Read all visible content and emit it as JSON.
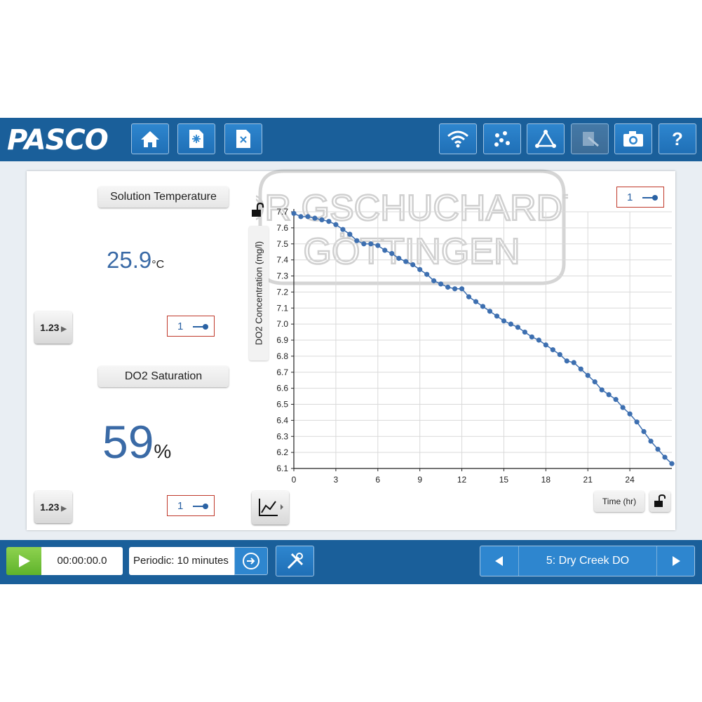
{
  "brand": {
    "logo": "PASCO"
  },
  "toolbar": {
    "left_icons": [
      "home-icon",
      "new-file-icon",
      "close-file-icon"
    ],
    "right_icons": [
      "wireless-icon",
      "data-points-icon",
      "analyze-icon",
      "journal-icon",
      "camera-icon",
      "help-icon"
    ],
    "help_label": "?"
  },
  "displays": {
    "temp": {
      "title": "Solution Temperature",
      "value": "25.9",
      "unit": "°C",
      "run": "1"
    },
    "sat": {
      "title": "DO2 Saturation",
      "value": "59",
      "unit": "%",
      "run": "1"
    },
    "digits_label": "1.23"
  },
  "graph": {
    "run": "1",
    "xlabel_button": "Time (hr)"
  },
  "controls": {
    "timer": "00:00:00.0",
    "sampling": "Periodic: 10 minutes",
    "page_label": "5: Dry Creek DO"
  },
  "watermark": {
    "text": "DR GSCHUCHARDT GÖTTINGEN"
  },
  "colors": {
    "accent": "#1a5f9a",
    "series": "#3d6fb0",
    "record": "#6cbf3a",
    "run_box": "#c0392b"
  },
  "chart_data": {
    "type": "scatter",
    "title": "",
    "xlabel": "Time (hr)",
    "ylabel": "DO2 Concentration (mg/l)",
    "xlim": [
      0,
      27
    ],
    "ylim": [
      6.1,
      7.7
    ],
    "x_ticks": [
      0,
      3,
      6,
      9,
      12,
      15,
      18,
      21,
      24
    ],
    "y_ticks": [
      6.1,
      6.2,
      6.3,
      6.4,
      6.5,
      6.6,
      6.7,
      6.8,
      6.9,
      7.0,
      7.1,
      7.2,
      7.3,
      7.4,
      7.5,
      7.6,
      7.7
    ],
    "grid": true,
    "legend": "none",
    "series": [
      {
        "x": [
          0,
          0.5,
          1,
          1.5,
          2,
          2.5,
          3,
          3.5,
          4,
          4.5,
          5,
          5.5,
          6,
          6.5,
          7,
          7.5,
          8,
          8.5,
          9,
          9.5,
          10,
          10.5,
          11,
          11.5,
          12,
          12.5,
          13,
          13.5,
          14,
          14.5,
          15,
          15.5,
          16,
          16.5,
          17,
          17.5,
          18,
          18.5,
          19,
          19.5,
          20,
          20.5,
          21,
          21.5,
          22,
          22.5,
          23,
          23.5,
          24,
          24.5,
          25,
          25.5,
          26,
          26.5,
          27
        ],
        "y": [
          7.69,
          7.67,
          7.67,
          7.66,
          7.65,
          7.64,
          7.62,
          7.59,
          7.56,
          7.52,
          7.5,
          7.5,
          7.49,
          7.46,
          7.44,
          7.41,
          7.39,
          7.37,
          7.34,
          7.31,
          7.27,
          7.25,
          7.23,
          7.22,
          7.22,
          7.17,
          7.14,
          7.11,
          7.08,
          7.05,
          7.02,
          7.0,
          6.98,
          6.95,
          6.92,
          6.9,
          6.87,
          6.84,
          6.81,
          6.77,
          6.76,
          6.72,
          6.68,
          6.64,
          6.59,
          6.56,
          6.53,
          6.48,
          6.44,
          6.39,
          6.33,
          6.27,
          6.22,
          6.17,
          6.13
        ]
      }
    ]
  }
}
